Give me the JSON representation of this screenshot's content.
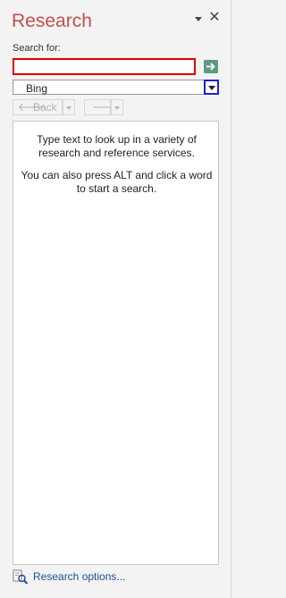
{
  "pane": {
    "title": "Research",
    "menu_icon": "dropdown-arrow-icon",
    "close_icon": "close-icon"
  },
  "search": {
    "label": "Search for:",
    "value": "",
    "placeholder": "",
    "go_icon": "arrow-right-icon"
  },
  "source": {
    "selected": "Bing",
    "arrow_icon": "chevron-down-icon"
  },
  "nav": {
    "back_label": "Back",
    "back_icon": "arrow-left-icon",
    "forward_icon": "arrow-right-icon"
  },
  "results": {
    "hint_1": "Type text to look up in a variety of research and reference services.",
    "hint_2": "You can also press ALT and click a word to start a search."
  },
  "footer": {
    "options_label": "Research options...",
    "options_icon": "research-options-icon"
  },
  "colors": {
    "title": "#c0504d",
    "highlight_red": "#e00000",
    "highlight_blue": "#1f1fd0",
    "go_button": "#5b9b83",
    "link": "#1f4e99"
  }
}
